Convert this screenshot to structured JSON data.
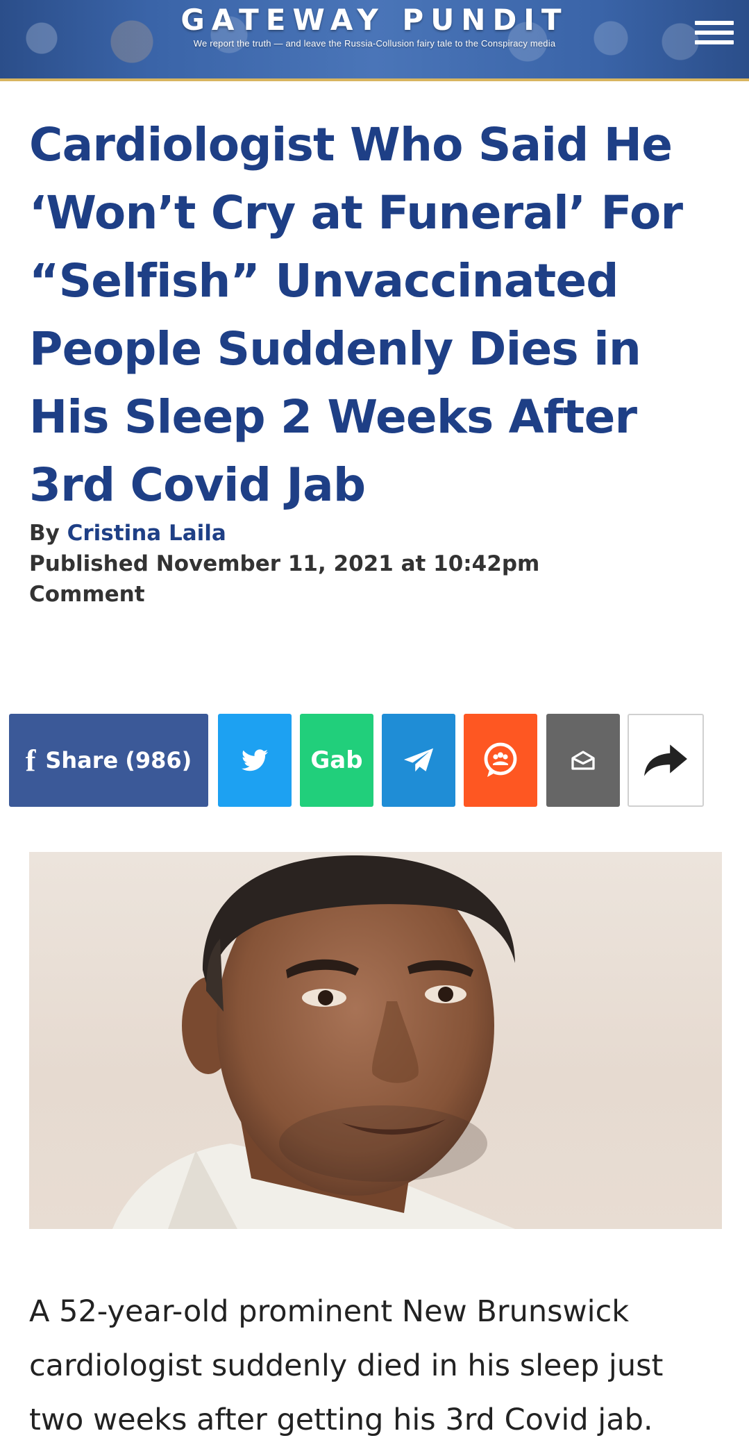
{
  "header": {
    "logo_text": "GATEWAY PUNDIT",
    "tagline": "We report the truth — and leave the Russia-Collusion fairy tale to the Conspiracy media",
    "menu_icon": "hamburger-menu-icon",
    "accent_color": "#d8b560"
  },
  "article": {
    "headline": "Cardiologist Who Said He ‘Won’t Cry at Funeral’ For “Selfish” Unvaccinated People Suddenly Dies in His Sleep 2 Weeks After 3rd Covid Jab",
    "by_label": "By",
    "author": "Cristina Laila",
    "published": "Published November 11, 2021 at 10:42pm",
    "comment_label": "Comment",
    "headline_color": "#1e3f86",
    "image_subject": "portrait photo of man",
    "paragraph": "A 52-year-old prominent New Brunswick cardiologist suddenly died in his sleep just two weeks after getting his 3rd Covid jab."
  },
  "share": {
    "facebook_label": "Share",
    "facebook_count": "(986)",
    "gab_label": "Gab",
    "facebook_color": "#3b5998",
    "twitter_color": "#1da1f2",
    "gab_color": "#21cf7b",
    "telegram_color": "#1f8dd6",
    "mewe_color": "#fe5722",
    "email_color": "#666666",
    "icons": [
      "facebook-icon",
      "twitter-icon",
      "telegram-icon",
      "mewe-icon",
      "email-icon",
      "share-arrow-icon"
    ]
  }
}
